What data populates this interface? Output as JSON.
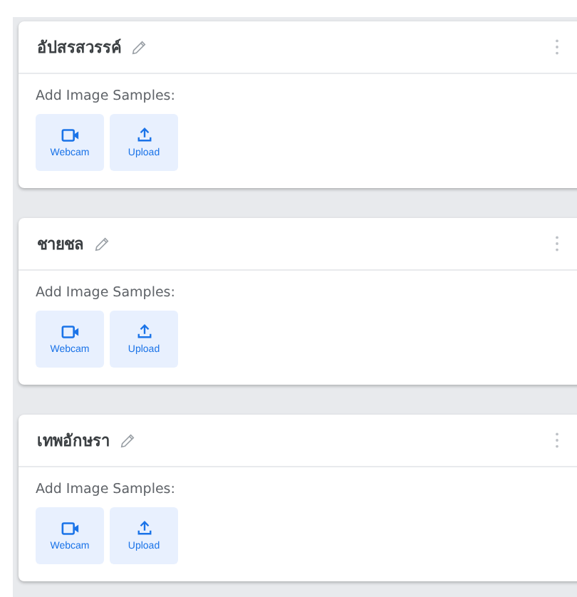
{
  "classes": [
    {
      "name": "อัปสรสวรรค์",
      "samples_label": "Add Image Samples:",
      "buttons": [
        {
          "kind": "webcam",
          "label": "Webcam"
        },
        {
          "kind": "upload",
          "label": "Upload"
        }
      ]
    },
    {
      "name": "ชายชล",
      "samples_label": "Add Image Samples:",
      "buttons": [
        {
          "kind": "webcam",
          "label": "Webcam"
        },
        {
          "kind": "upload",
          "label": "Upload"
        }
      ]
    },
    {
      "name": "เทพอักษรา",
      "samples_label": "Add Image Samples:",
      "buttons": [
        {
          "kind": "webcam",
          "label": "Webcam"
        },
        {
          "kind": "upload",
          "label": "Upload"
        }
      ]
    }
  ]
}
